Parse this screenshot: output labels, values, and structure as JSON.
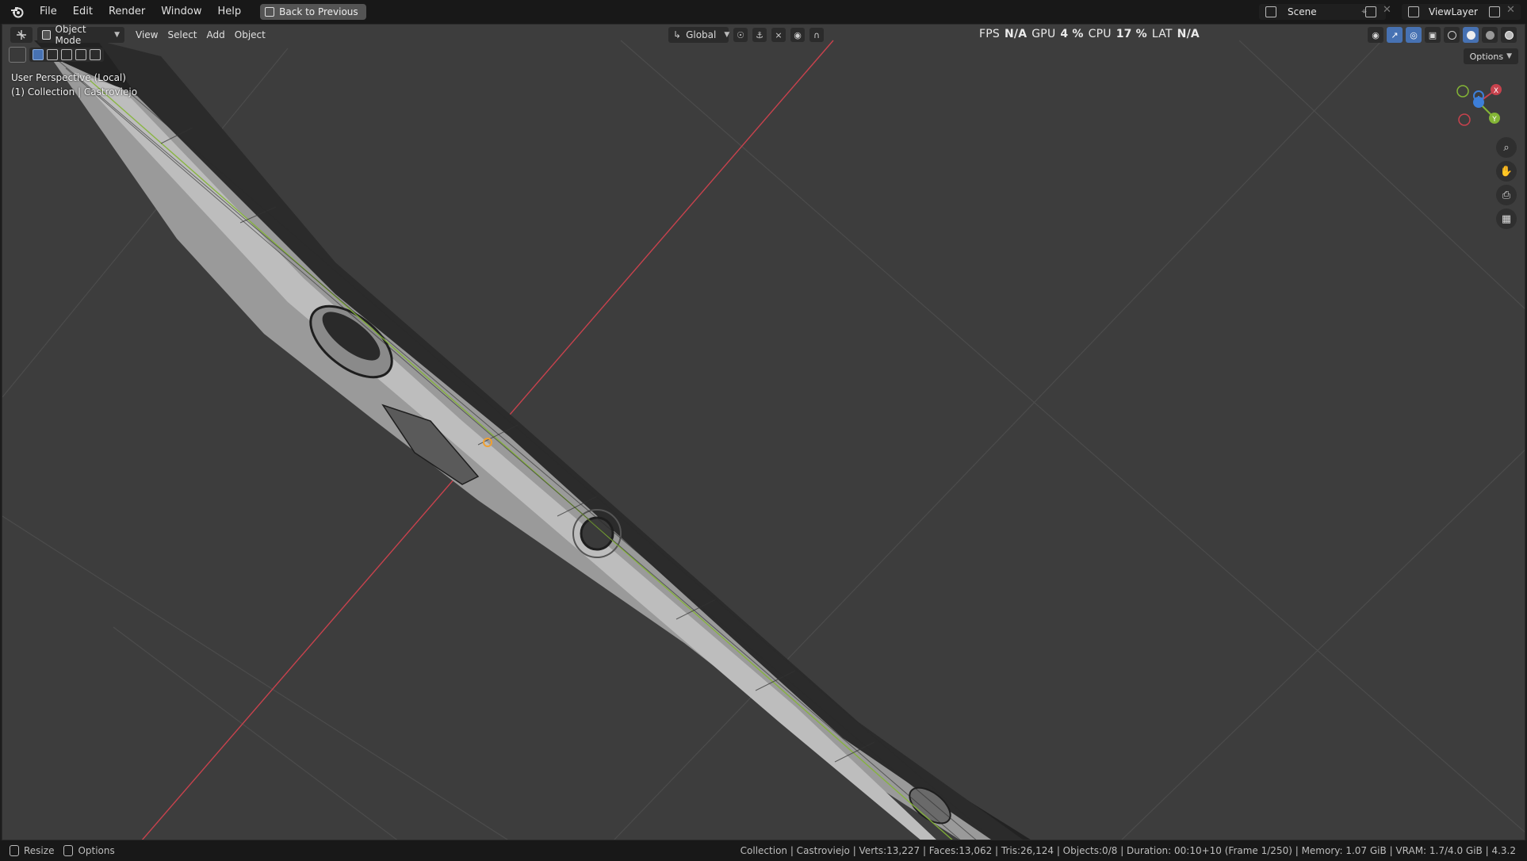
{
  "menu": {
    "items": [
      "File",
      "Edit",
      "Render",
      "Window",
      "Help"
    ],
    "back_button": "Back to Previous"
  },
  "scene": {
    "name": "Scene",
    "view_layer": "ViewLayer"
  },
  "viewport_header": {
    "mode": "Object Mode",
    "menus": [
      "View",
      "Select",
      "Add",
      "Object"
    ],
    "transform_orientation": "Global",
    "options": "Options"
  },
  "stats": {
    "fps_label": "FPS",
    "fps": "N/A",
    "gpu_label": "GPU",
    "gpu": "4 %",
    "cpu_label": "CPU",
    "cpu": "17 %",
    "lat_label": "LAT",
    "lat": "N/A"
  },
  "overlay": {
    "view_name": "User Perspective (Local)",
    "collection": "(1) Collection | Castroviejo"
  },
  "gizmo": {
    "x": "X",
    "y": "Y"
  },
  "statusbar": {
    "resize": "Resize",
    "options": "Options",
    "info": "Collection | Castroviejo | Verts:13,227 | Faces:13,062 | Tris:26,124 | Objects:0/8 | Duration: 00:10+10 (Frame 1/250) | Memory: 1.07 GiB | VRAM: 1.7/4.0 GiB | 4.3.2"
  },
  "colors": {
    "viewport_bg": "#3d3d3d",
    "x_axis": "#c8424d",
    "y_axis": "#84b536",
    "z_axis": "#3d7fd9",
    "accent": "#4772b3"
  }
}
